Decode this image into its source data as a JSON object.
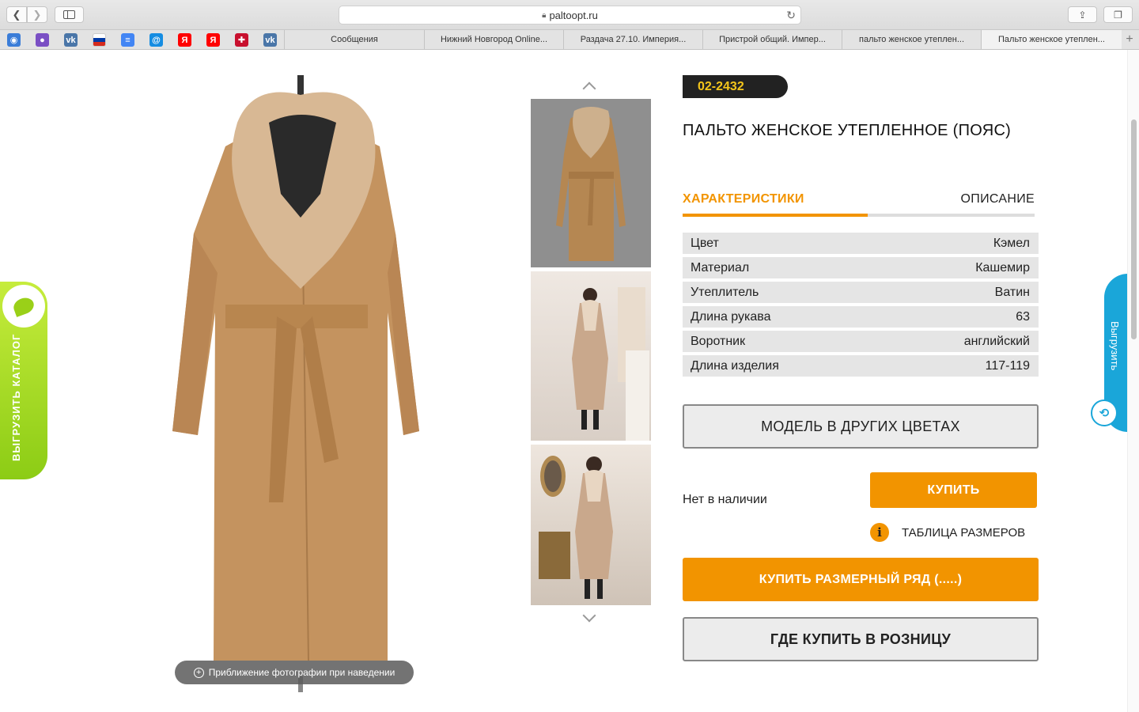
{
  "browser": {
    "url": "paltoopt.ru",
    "bookmarks": [
      {
        "icon": "globe-icon",
        "glyph": "◉",
        "color": "#3b7dd8"
      },
      {
        "icon": "user-icon",
        "glyph": "●",
        "color": "#7a4fc4"
      },
      {
        "icon": "vk-icon",
        "glyph": "vk",
        "color": "#4a76a8"
      },
      {
        "icon": "russia-flag-icon",
        "glyph": "",
        "color": "#d52b1e"
      },
      {
        "icon": "docs-icon",
        "glyph": "≡",
        "color": "#4285f4"
      },
      {
        "icon": "mail-icon",
        "glyph": "@",
        "color": "#168de2"
      },
      {
        "icon": "yandex-icon",
        "glyph": "Я",
        "color": "#ff0000"
      },
      {
        "icon": "yandex-icon-2",
        "glyph": "Я",
        "color": "#ff0000"
      },
      {
        "icon": "crest-icon",
        "glyph": "✚",
        "color": "#c8102e"
      },
      {
        "icon": "vk-icon-2",
        "glyph": "vk",
        "color": "#4a76a8"
      }
    ],
    "tabs": [
      {
        "label": "Сообщения"
      },
      {
        "label": "Нижний Новгород Online..."
      },
      {
        "label": "Раздача 27.10. Империя..."
      },
      {
        "label": "Пристрой общий. Импер..."
      },
      {
        "label": "пальто женское утеплен..."
      },
      {
        "label": "Пальто женское утеплен..."
      }
    ]
  },
  "catalog_tab": {
    "label": "ВЫГРУЗИТЬ КАТАЛОГ"
  },
  "unload_tab": {
    "label": "Выгрузить"
  },
  "gallery": {
    "zoom_hint": "Приближение фотографии при наведении"
  },
  "product": {
    "sku": "02-2432",
    "title": "ПАЛЬТО ЖЕНСКОЕ УТЕПЛЕННОЕ (ПОЯС)",
    "tabs": {
      "characteristics": "ХАРАКТЕРИСТИКИ",
      "description": "ОПИСАНИЕ"
    },
    "specs": [
      {
        "name": "Цвет",
        "value": "Кэмел"
      },
      {
        "name": "Материал",
        "value": "Кашемир"
      },
      {
        "name": "Утеплитель",
        "value": "Ватин"
      },
      {
        "name": "Длина рукава",
        "value": "63"
      },
      {
        "name": "Воротник",
        "value": "английский"
      },
      {
        "name": "Длина изделия",
        "value": "117-119"
      }
    ],
    "other_colors_label": "МОДЕЛЬ В ДРУГИХ ЦВЕТАХ",
    "stock_status": "Нет в наличии",
    "buy_label": "КУПИТЬ",
    "size_table_label": "ТАБЛИЦА РАЗМЕРОВ",
    "buy_range_label": "КУПИТЬ РАЗМЕРНЫЙ РЯД (.....)",
    "retail_label": "ГДЕ КУПИТЬ В РОЗНИЦУ"
  },
  "colors": {
    "accent": "#f29400",
    "sku_text": "#f5c61b",
    "catalog_green": "#9ad018",
    "unload_blue": "#1aa6d9"
  }
}
